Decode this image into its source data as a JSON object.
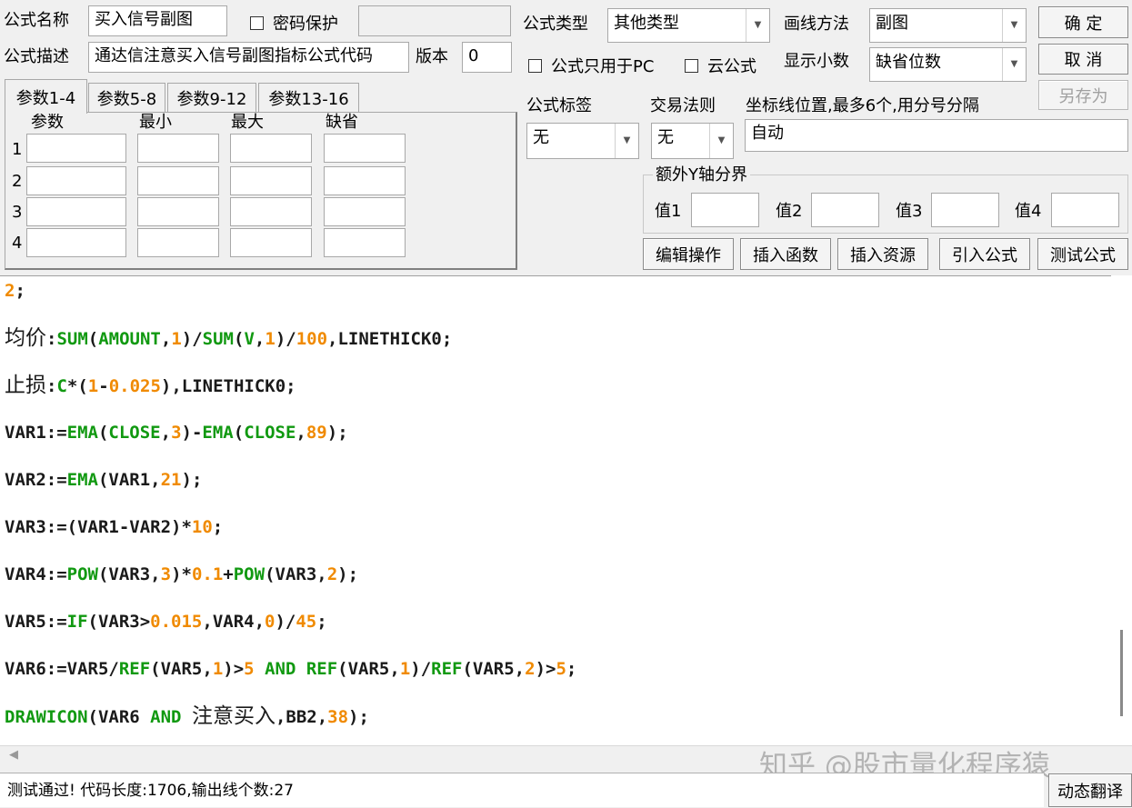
{
  "header": {
    "name_label": "公式名称",
    "name_value": "买入信号副图",
    "password_label": "密码保护",
    "desc_label": "公式描述",
    "desc_value": "通达信注意买入信号副图指标公式代码",
    "version_label": "版本",
    "version_value": "0",
    "type_label": "公式类型",
    "type_value": "其他类型",
    "draw_label": "画线方法",
    "draw_value": "副图",
    "pc_only_label": "公式只用于PC",
    "cloud_label": "云公式",
    "decimals_label": "显示小数",
    "decimals_value": "缺省位数"
  },
  "buttons": {
    "ok": "确 定",
    "cancel": "取 消",
    "save_as": "另存为",
    "edit_ops": "编辑操作",
    "insert_func": "插入函数",
    "insert_res": "插入资源",
    "import_formula": "引入公式",
    "test_formula": "测试公式",
    "dyn_translate": "动态翻译"
  },
  "tabs": [
    "参数1-4",
    "参数5-8",
    "参数9-12",
    "参数13-16"
  ],
  "params": {
    "headers": [
      "参数",
      "最小",
      "最大",
      "缺省"
    ],
    "rows": [
      "1",
      "2",
      "3",
      "4"
    ]
  },
  "right_panel": {
    "tag_label": "公式标签",
    "tag_value": "无",
    "trade_label": "交易法则",
    "trade_value": "无",
    "coord_label": "坐标线位置,最多6个,用分号分隔",
    "coord_value": "自动",
    "yaxis_group": "额外Y轴分界",
    "v1": "值1",
    "v2": "值2",
    "v3": "值3",
    "v4": "值4"
  },
  "code": [
    [
      [
        "2",
        "num"
      ],
      [
        ";",
        "plain"
      ]
    ],
    [
      [
        "均价",
        "cn"
      ],
      [
        ":",
        "plain"
      ],
      [
        "SUM",
        "fn"
      ],
      [
        "(",
        "plain"
      ],
      [
        "AMOUNT",
        "fn"
      ],
      [
        ",",
        "plain"
      ],
      [
        "1",
        "num"
      ],
      [
        ")/",
        "plain"
      ],
      [
        "SUM",
        "fn"
      ],
      [
        "(",
        "plain"
      ],
      [
        "V",
        "fn"
      ],
      [
        ",",
        "plain"
      ],
      [
        "1",
        "num"
      ],
      [
        ")/",
        "plain"
      ],
      [
        "100",
        "num"
      ],
      [
        ",LINETHICK0;",
        "plain"
      ]
    ],
    [
      [
        "止损",
        "cn"
      ],
      [
        ":",
        "plain"
      ],
      [
        "C",
        "fn"
      ],
      [
        "*(",
        "plain"
      ],
      [
        "1",
        "num"
      ],
      [
        "-",
        "plain"
      ],
      [
        "0.025",
        "num"
      ],
      [
        "),LINETHICK0;",
        "plain"
      ]
    ],
    [
      [
        "VAR1:=",
        "plain"
      ],
      [
        "EMA",
        "fn"
      ],
      [
        "(",
        "plain"
      ],
      [
        "CLOSE",
        "fn"
      ],
      [
        ",",
        "plain"
      ],
      [
        "3",
        "num"
      ],
      [
        ")-",
        "plain"
      ],
      [
        "EMA",
        "fn"
      ],
      [
        "(",
        "plain"
      ],
      [
        "CLOSE",
        "fn"
      ],
      [
        ",",
        "plain"
      ],
      [
        "89",
        "num"
      ],
      [
        ");",
        "plain"
      ]
    ],
    [
      [
        "VAR2:=",
        "plain"
      ],
      [
        "EMA",
        "fn"
      ],
      [
        "(VAR1,",
        "plain"
      ],
      [
        "21",
        "num"
      ],
      [
        ");",
        "plain"
      ]
    ],
    [
      [
        "VAR3:=(VAR1-VAR2)*",
        "plain"
      ],
      [
        "10",
        "num"
      ],
      [
        ";",
        "plain"
      ]
    ],
    [
      [
        "VAR4:=",
        "plain"
      ],
      [
        "POW",
        "fn"
      ],
      [
        "(VAR3,",
        "plain"
      ],
      [
        "3",
        "num"
      ],
      [
        ")*",
        "plain"
      ],
      [
        "0.1",
        "num"
      ],
      [
        "+",
        "plain"
      ],
      [
        "POW",
        "fn"
      ],
      [
        "(VAR3,",
        "plain"
      ],
      [
        "2",
        "num"
      ],
      [
        ");",
        "plain"
      ]
    ],
    [
      [
        "VAR5:=",
        "plain"
      ],
      [
        "IF",
        "fn"
      ],
      [
        "(VAR3>",
        "plain"
      ],
      [
        "0.015",
        "num"
      ],
      [
        ",VAR4,",
        "plain"
      ],
      [
        "0",
        "num"
      ],
      [
        ")/",
        "plain"
      ],
      [
        "45",
        "num"
      ],
      [
        ";",
        "plain"
      ]
    ],
    [
      [
        "VAR6:=VAR5/",
        "plain"
      ],
      [
        "REF",
        "fn"
      ],
      [
        "(VAR5,",
        "plain"
      ],
      [
        "1",
        "num"
      ],
      [
        ")>",
        "plain"
      ],
      [
        "5",
        "num"
      ],
      [
        " ",
        "plain"
      ],
      [
        "AND",
        "fn"
      ],
      [
        " ",
        "plain"
      ],
      [
        "REF",
        "fn"
      ],
      [
        "(VAR5,",
        "plain"
      ],
      [
        "1",
        "num"
      ],
      [
        ")/",
        "plain"
      ],
      [
        "REF",
        "fn"
      ],
      [
        "(VAR5,",
        "plain"
      ],
      [
        "2",
        "num"
      ],
      [
        ")>",
        "plain"
      ],
      [
        "5",
        "num"
      ],
      [
        ";",
        "plain"
      ]
    ],
    [
      [
        "DRAWICON",
        "fn"
      ],
      [
        "(VAR6 ",
        "plain"
      ],
      [
        "AND",
        "fn"
      ],
      [
        " ",
        "plain"
      ],
      [
        "注意买入",
        "cn"
      ],
      [
        ",BB2,",
        "plain"
      ],
      [
        "38",
        "num"
      ],
      [
        ");",
        "plain"
      ]
    ]
  ],
  "status_text": "测试通过! 代码长度:1706,输出线个数:27",
  "watermark": "知乎 @股市量化程序猿",
  "colors": {
    "function": "#119911",
    "number": "#f08a00",
    "plain": "#1a1a1a"
  }
}
